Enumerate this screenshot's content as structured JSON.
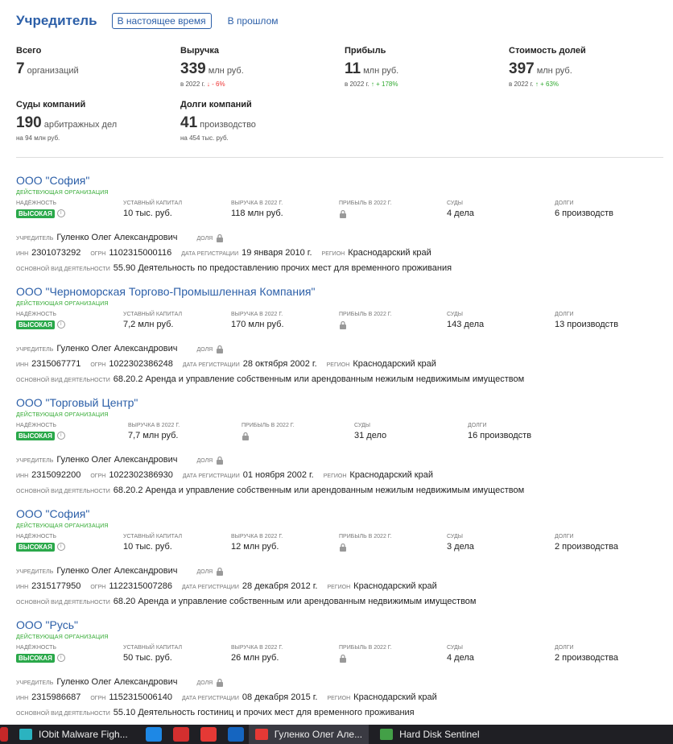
{
  "header": {
    "title": "Учредитель",
    "tab_present": "В настоящее время",
    "tab_past": "В прошлом"
  },
  "stats": [
    {
      "label": "Всего",
      "value": "7",
      "unit": "организаций",
      "sub": "",
      "change": ""
    },
    {
      "label": "Выручка",
      "value": "339",
      "unit": "млн руб.",
      "sub": "в 2022 г.",
      "change": "↓ - 6%"
    },
    {
      "label": "Прибыль",
      "value": "11",
      "unit": "млн руб.",
      "sub": "в 2022 г.",
      "change": "↑ + 178%"
    },
    {
      "label": "Стоимость долей",
      "value": "397",
      "unit": "млн руб.",
      "sub": "в 2022 г.",
      "change": "↑ + 63%"
    },
    {
      "label": "Суды компаний",
      "value": "190",
      "unit": "арбитражных дел",
      "sub": "на 94 млн руб.",
      "change": ""
    },
    {
      "label": "Долги компаний",
      "value": "41",
      "unit": "производство",
      "sub": "на 454 тыс. руб.",
      "change": ""
    }
  ],
  "labels": {
    "status": "ДЕЙСТВУЮЩАЯ ОРГАНИЗАЦИЯ",
    "reliability": "НАДЁЖНОСТЬ",
    "capital": "УСТАВНЫЙ КАПИТАЛ",
    "revenue": "ВЫРУЧКА В 2022 Г.",
    "profit": "ПРИБЫЛЬ В 2022 Г.",
    "courts": "СУДЫ",
    "debts": "ДОЛГИ",
    "founder": "УЧРЕДИТЕЛЬ",
    "share": "ДОЛЯ",
    "inn": "ИНН",
    "ogrn": "ОГРН",
    "reg_date": "ДАТА РЕГИСТРАЦИИ",
    "region": "РЕГИОН",
    "activity": "ОСНОВНОЙ ВИД ДЕЯТЕЛЬНОСТИ",
    "high": "ВЫСОКАЯ"
  },
  "orgs": [
    {
      "name": "ООО \"София\"",
      "capital": "10 тыс. руб.",
      "revenue": "118 млн руб.",
      "courts": "4 дела",
      "debts": "6 производств",
      "founder": "Гуленко Олег Александрович",
      "inn": "2301073292",
      "ogrn": "1102315000116",
      "reg_date": "19 января 2010 г.",
      "region": "Краснодарский край",
      "activity": "55.90 Деятельность по предоставлению прочих мест для временного проживания"
    },
    {
      "name": "ООО \"Черноморская Торгово-Промышленная Компания\"",
      "capital": "7,2 млн руб.",
      "revenue": "170 млн руб.",
      "courts": "143 дела",
      "debts": "13 производств",
      "founder": "Гуленко Олег Александрович",
      "inn": "2315067771",
      "ogrn": "1022302386248",
      "reg_date": "28 октября 2002 г.",
      "region": "Краснодарский край",
      "activity": "68.20.2 Аренда и управление собственным или арендованным нежилым недвижимым имуществом"
    },
    {
      "name": "ООО \"Торговый Центр\"",
      "capital": "",
      "revenue": "7,7 млн руб.",
      "courts": "31 дело",
      "debts": "16 производств",
      "founder": "Гуленко Олег Александрович",
      "inn": "2315092200",
      "ogrn": "1022302386930",
      "reg_date": "01 ноября 2002 г.",
      "region": "Краснодарский край",
      "activity": "68.20.2 Аренда и управление собственным или арендованным нежилым недвижимым имуществом"
    },
    {
      "name": "ООО \"София\"",
      "capital": "10 тыс. руб.",
      "revenue": "12 млн руб.",
      "courts": "3 дела",
      "debts": "2 производства",
      "founder": "Гуленко Олег Александрович",
      "inn": "2315177950",
      "ogrn": "1122315007286",
      "reg_date": "28 декабря 2012 г.",
      "region": "Краснодарский край",
      "activity": "68.20 Аренда и управление собственным или арендованным недвижимым имуществом"
    },
    {
      "name": "ООО \"Русь\"",
      "capital": "50 тыс. руб.",
      "revenue": "26 млн руб.",
      "courts": "4 дела",
      "debts": "2 производства",
      "founder": "Гуленко Олег Александрович",
      "inn": "2315986687",
      "ogrn": "1152315006140",
      "reg_date": "08 декабря 2015 г.",
      "region": "Краснодарский край",
      "activity": "55.10 Деятельность гостиниц и прочих мест для временного проживания"
    }
  ],
  "taskbar": {
    "items": [
      {
        "label": "IObit Malware Figh...",
        "color": "#2bb3c0"
      },
      {
        "label": "Гуленко Олег Але...",
        "color": "#e53935"
      },
      {
        "label": "Hard Disk Sentinel",
        "color": "#43a047"
      }
    ],
    "icons": [
      {
        "name": "security-app-icon",
        "color": "#1e88e5"
      },
      {
        "name": "media-app-icon",
        "color": "#d32f2f"
      },
      {
        "name": "opera-icon",
        "color": "#e53935"
      },
      {
        "name": "ccleaner-icon",
        "color": "#1565c0"
      }
    ]
  }
}
